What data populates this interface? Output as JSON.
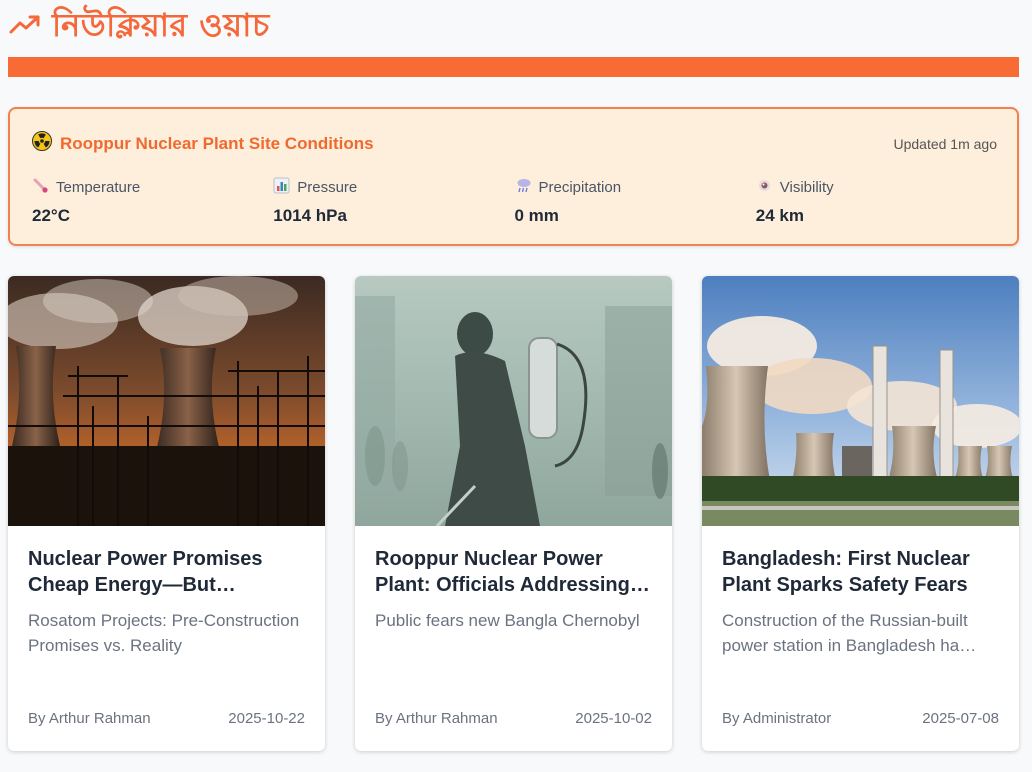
{
  "site": {
    "title": "নিউক্লিয়ার ওয়াচ",
    "logo_icon": "trending-up-icon",
    "accent": "#f96b35"
  },
  "conditions": {
    "title_icon": "radioactive-icon",
    "title": "Rooppur Nuclear Plant Site Conditions",
    "updated": "Updated 1m ago",
    "metrics": [
      {
        "icon": "thermometer-icon",
        "label": "Temperature",
        "value": "22°C"
      },
      {
        "icon": "bar-chart-icon",
        "label": "Pressure",
        "value": "1014 hPa"
      },
      {
        "icon": "rain-cloud-icon",
        "label": "Precipitation",
        "value": "0 mm"
      },
      {
        "icon": "eye-icon",
        "label": "Visibility",
        "value": "24 km"
      }
    ]
  },
  "articles": [
    {
      "title": "Nuclear Power Promises Cheap Energy—But…",
      "subtitle": "Rosatom Projects: Pre-Construction Promises vs. Reality",
      "author": "By Arthur Rahman",
      "date": "2025-10-22"
    },
    {
      "title": "Rooppur Nuclear Power Plant: Officials Addressing…",
      "subtitle": "Public fears new Bangla Chernobyl",
      "author": "By Arthur Rahman",
      "date": "2025-10-02"
    },
    {
      "title": "Bangladesh: First Nuclear Plant Sparks Safety Fears",
      "subtitle": "Construction of the Russian-built power station in Bangladesh ha…",
      "author": "By Administrator",
      "date": "2025-07-08"
    }
  ]
}
